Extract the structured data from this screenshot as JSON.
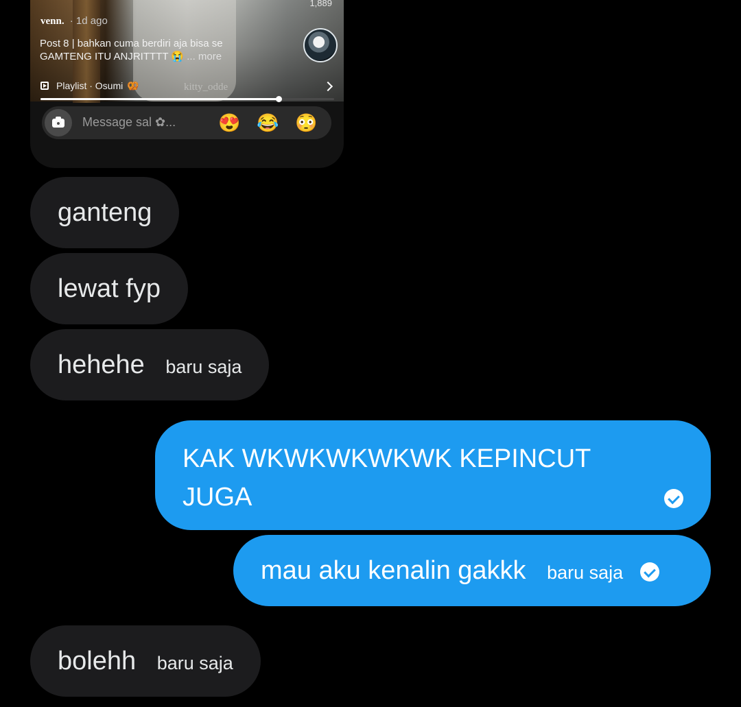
{
  "shared_reel": {
    "view_count": "1,889",
    "author": "venn.",
    "time_ago": "· 1d ago",
    "caption": "Post 8 | bahkan cuma berdiri aja bisa se GAMTENG ITU ANJRITTTT 😭",
    "caption_more": "... more",
    "playlist_label": "Playlist · Osumi",
    "playlist_emoji": "🥨",
    "watermark": "kitty_odde",
    "progress": 0.81,
    "message_placeholder": "Message sal ✿...",
    "reactions": [
      "😍",
      "😂",
      "😳"
    ]
  },
  "messages": [
    {
      "direction": "in",
      "text": "ganteng",
      "time": ""
    },
    {
      "direction": "in",
      "text": "lewat fyp",
      "time": ""
    },
    {
      "direction": "in",
      "text": "hehehe",
      "time": "baru saja"
    },
    {
      "direction": "out",
      "text_line1": "KAK WKWKWKWKWK KEPINCUT",
      "text_line2": "JUGA",
      "time": "",
      "read": true
    },
    {
      "direction": "out",
      "text": "mau aku kenalin gakkk",
      "time": "baru saja",
      "read": true
    },
    {
      "direction": "in",
      "text": "bolehh",
      "time": "baru saja"
    }
  ],
  "colors": {
    "background": "#000000",
    "incoming_bubble": "#1c1c1e",
    "outgoing_bubble": "#1d9bf0"
  },
  "icons": {
    "camera": "camera-icon",
    "read_receipt": "check-circle-icon",
    "playlist": "playlist-icon",
    "chevron": "chevron-right-icon"
  }
}
